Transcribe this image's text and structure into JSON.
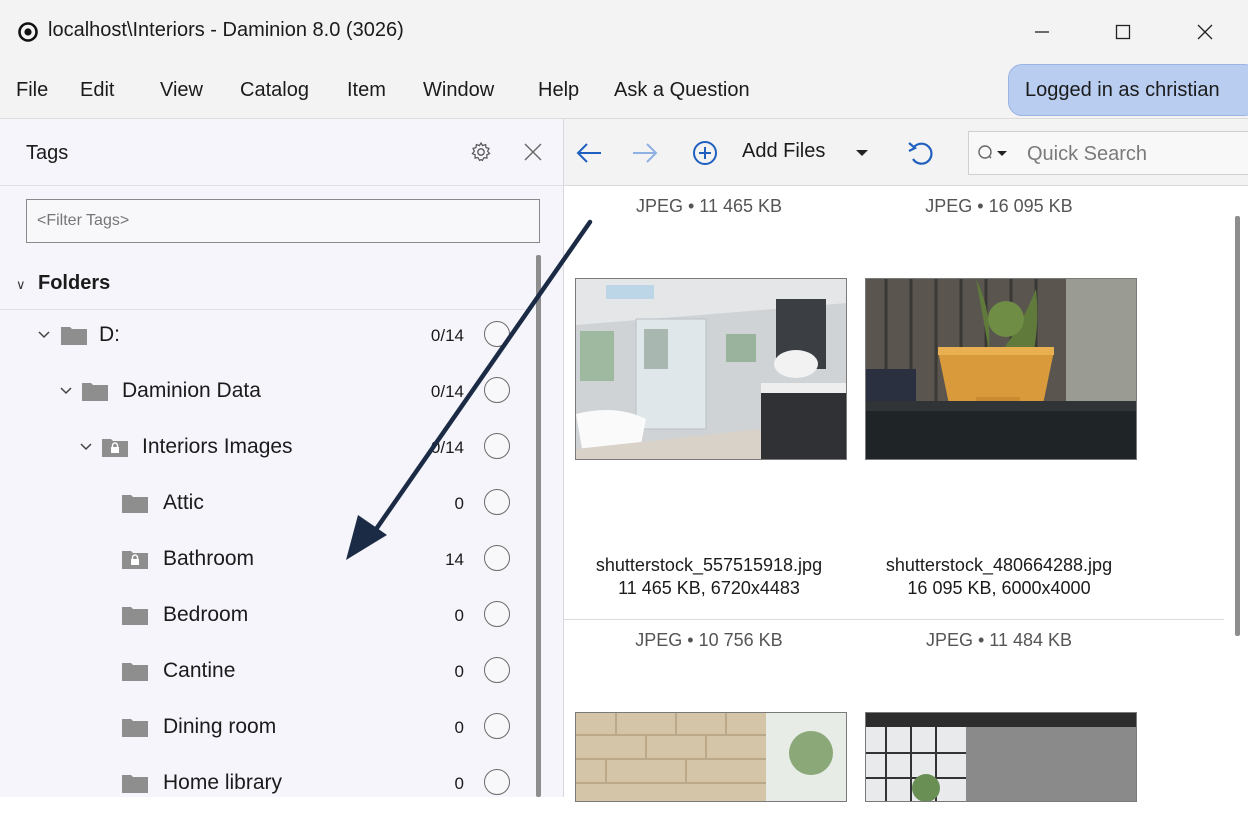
{
  "window": {
    "title": "localhost\\Interiors - Daminion 8.0 (3026)",
    "logo_icon": "daminion-logo-icon",
    "controls": [
      "minimize-icon",
      "maximize-icon",
      "close-icon"
    ]
  },
  "menu": {
    "items": [
      "File",
      "Edit",
      "View",
      "Catalog",
      "Item",
      "Window",
      "Help",
      "Ask a Question"
    ],
    "login_label": "Logged in as christian"
  },
  "tags_panel": {
    "title": "Tags",
    "filter_placeholder": "<Filter Tags>",
    "folders_label": "Folders",
    "tree": [
      {
        "label": "D:",
        "count": "0/14",
        "level": 0,
        "expanded": true,
        "icon": "folder-icon"
      },
      {
        "label": "Daminion Data",
        "count": "0/14",
        "level": 1,
        "expanded": true,
        "icon": "folder-icon"
      },
      {
        "label": "Interiors Images",
        "count": "0/14",
        "level": 2,
        "expanded": true,
        "icon": "locked-folder-icon"
      },
      {
        "label": "Attic",
        "count": "0",
        "level": 3,
        "icon": "folder-icon"
      },
      {
        "label": "Bathroom",
        "count": "14",
        "level": 3,
        "icon": "locked-folder-icon"
      },
      {
        "label": "Bedroom",
        "count": "0",
        "level": 3,
        "icon": "folder-icon"
      },
      {
        "label": "Cantine",
        "count": "0",
        "level": 3,
        "icon": "folder-icon"
      },
      {
        "label": "Dining room",
        "count": "0",
        "level": 3,
        "icon": "folder-icon"
      },
      {
        "label": "Home library",
        "count": "0",
        "level": 3,
        "icon": "folder-icon"
      }
    ]
  },
  "toolbar": {
    "add_files_label": "Add Files",
    "search_placeholder": "Quick Search"
  },
  "items": [
    {
      "top_meta": "JPEG • 11 465 KB",
      "filename": "shutterstock_557515918.jpg",
      "details": "11 465 KB, 6720x4483"
    },
    {
      "top_meta": "JPEG • 16 095 KB",
      "filename": "shutterstock_480664288.jpg",
      "details": "16 095 KB, 6000x4000"
    },
    {
      "top_meta": "JPEG • 10 756 KB"
    },
    {
      "top_meta": "JPEG • 11 484 KB"
    }
  ],
  "colors": {
    "accent": "#1f5fbf",
    "login_bg": "#b9cdf0",
    "panel_bg": "#f5f5fb",
    "arrow": "#1c2b45"
  }
}
